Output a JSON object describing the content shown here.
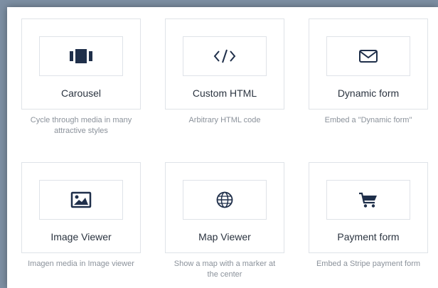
{
  "widgets": [
    {
      "title": "Carousel",
      "description": "Cycle through media in many attractive styles",
      "icon": "carousel-icon"
    },
    {
      "title": "Custom HTML",
      "description": "Arbitrary HTML code",
      "icon": "code-icon"
    },
    {
      "title": "Dynamic form",
      "description": "Embed a \"Dynamic form\"",
      "icon": "envelope-icon"
    },
    {
      "title": "Image Viewer",
      "description": "Imagen media in Image viewer",
      "icon": "image-icon"
    },
    {
      "title": "Map Viewer",
      "description": "Show a map with a marker at the center",
      "icon": "globe-icon"
    },
    {
      "title": "Payment form",
      "description": "Embed a Stripe payment form",
      "icon": "cart-icon"
    }
  ],
  "colors": {
    "icon": "#1f2f4a",
    "title": "#2b3440",
    "description": "#8b929b",
    "border": "#dfe3e8"
  }
}
